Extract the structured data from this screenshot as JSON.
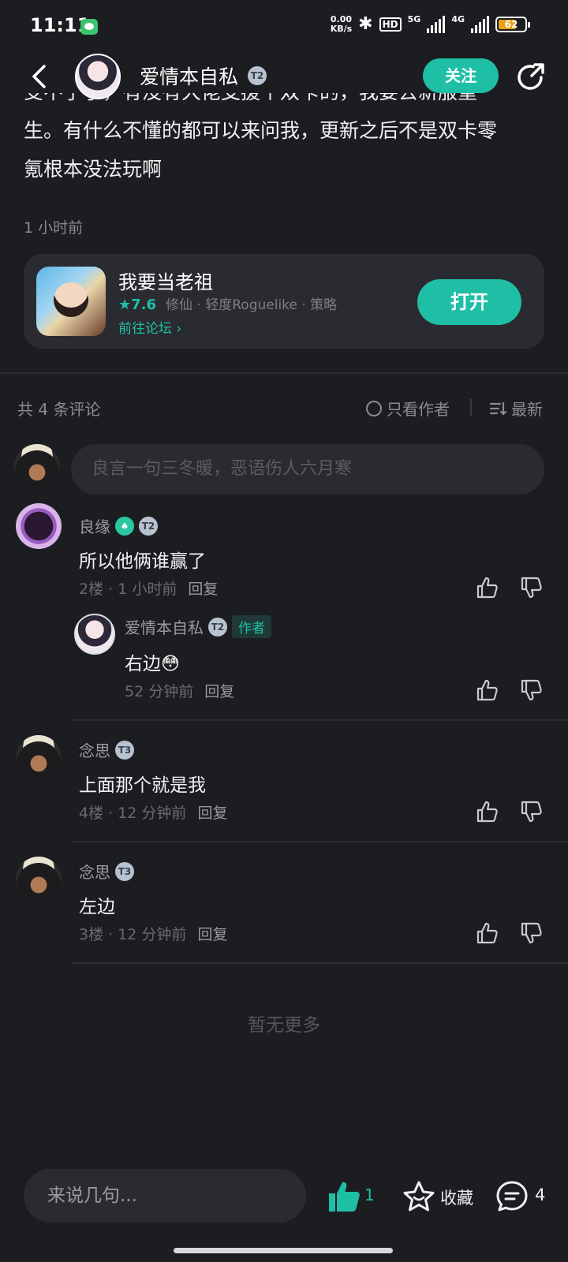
{
  "status_bar": {
    "time": "11:11",
    "net_speed_value": "0.00",
    "net_speed_unit": "KB/s",
    "hd_label": "HD",
    "net_5g": "5G",
    "net_4g": "4G",
    "battery": "62"
  },
  "header": {
    "author_name": "爱情本自私",
    "level": "2",
    "follow_label": "关注"
  },
  "post": {
    "text_partial": "受不了了，有没有大佬支援个双卡的，我要去新服重",
    "text_line2": "生。有什么不懂的都可以来问我，更新之后不是双卡零",
    "text_line3": "氪根本没法玩啊",
    "time": "1 小时前"
  },
  "game_card": {
    "title": "我要当老祖",
    "rating": "7.6",
    "tags": "修仙 · 轻度Roguelike · 策略",
    "forum_link": "前往论坛",
    "open_label": "打开"
  },
  "comments_header": {
    "count_text": "共 4 条评论",
    "author_only": "只看作者",
    "sort_label": "最新"
  },
  "comment_input": {
    "placeholder": "良言一句三冬暖，恶语伤人六月寒"
  },
  "comments": [
    {
      "name": "良缘",
      "level": "2",
      "text": "所以他俩谁赢了",
      "floor": "2楼",
      "time": "1 小时前",
      "reply_label": "回复",
      "replies": [
        {
          "name": "爱情本自私",
          "level": "2",
          "author_tag": "作者",
          "text": "右边",
          "emoji": "😳",
          "time": "52 分钟前",
          "reply_label": "回复"
        }
      ]
    },
    {
      "name": "念思",
      "level": "3",
      "text": "上面那个就是我",
      "floor": "4楼",
      "time": "12 分钟前",
      "reply_label": "回复"
    },
    {
      "name": "念思",
      "level": "3",
      "text": "左边",
      "floor": "3楼",
      "time": "12 分钟前",
      "reply_label": "回复"
    }
  ],
  "no_more": "暂无更多",
  "bottom_bar": {
    "input_placeholder": "来说几句...",
    "like_count": "1",
    "favorite_label": "收藏",
    "comment_count": "4"
  },
  "colors": {
    "background": "#1c1d21",
    "accent": "#1fbfa6",
    "card": "#2a2b30"
  }
}
